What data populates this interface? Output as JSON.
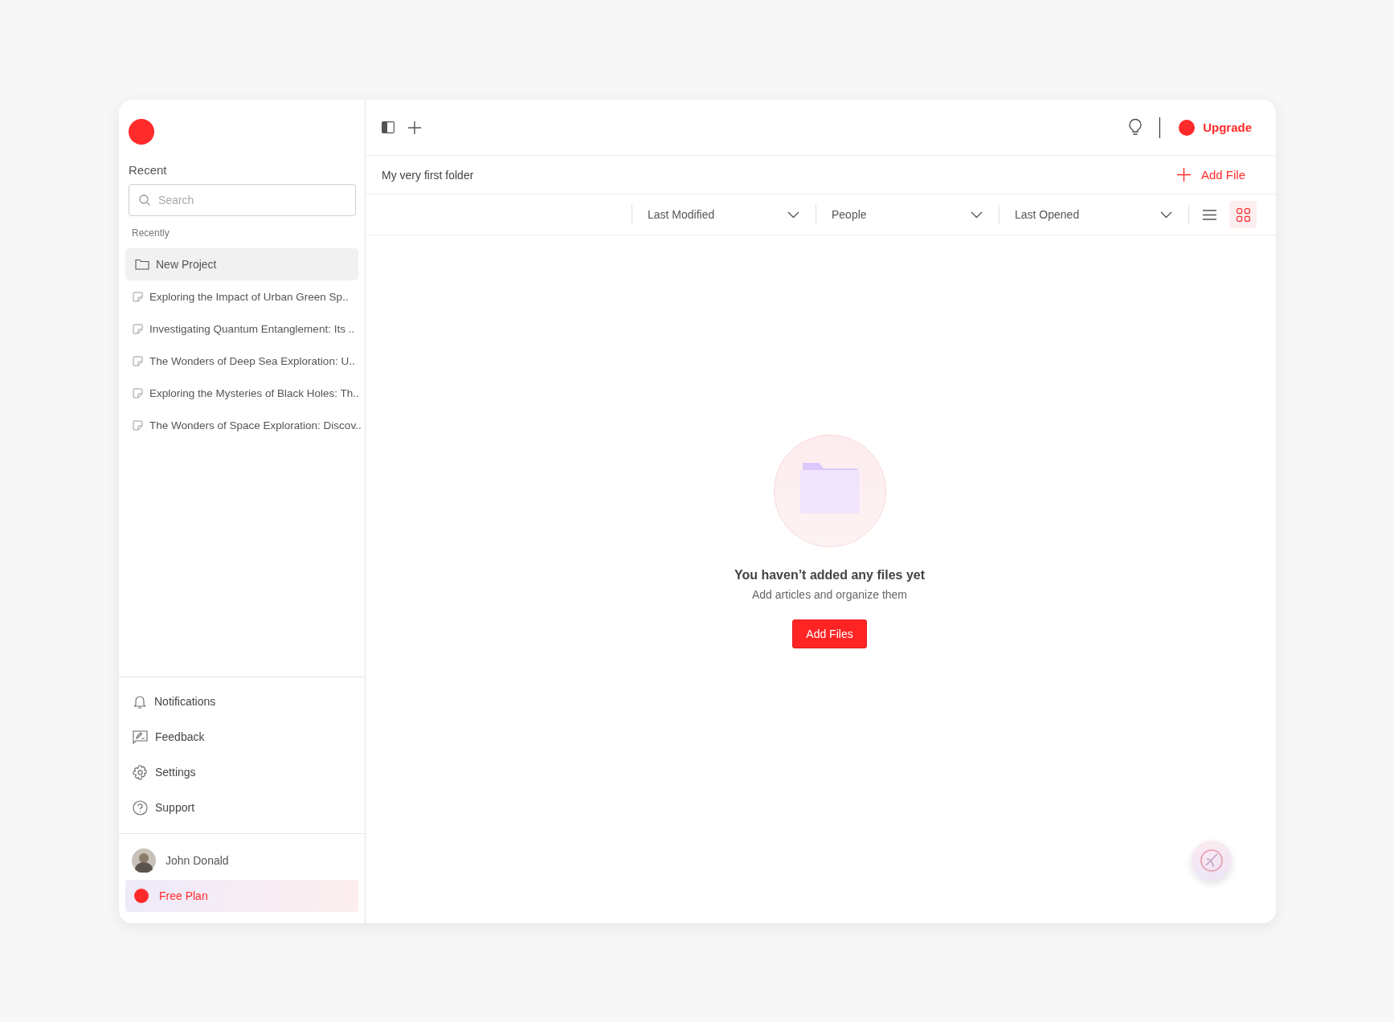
{
  "sidebar": {
    "section_title": "Recent",
    "search": {
      "placeholder": "Search"
    },
    "group_label": "Recently",
    "items": [
      {
        "kind": "folder",
        "label": "New Project",
        "selected": true
      },
      {
        "kind": "document",
        "label": "Exploring the Impact of Urban Green Sp..",
        "selected": false
      },
      {
        "kind": "document",
        "label": "Investigating Quantum Entanglement: Its ..",
        "selected": false
      },
      {
        "kind": "document",
        "label": "The Wonders of Deep Sea Exploration: U..",
        "selected": false
      },
      {
        "kind": "document",
        "label": "Exploring the Mysteries of Black Holes: Th..",
        "selected": false
      },
      {
        "kind": "document",
        "label": "The Wonders of Space Exploration: Discov..",
        "selected": false
      }
    ],
    "nav": [
      {
        "kind": "notifications",
        "label": "Notifications"
      },
      {
        "kind": "feedback",
        "label": "Feedback"
      },
      {
        "kind": "settings",
        "label": "Settings"
      },
      {
        "kind": "support",
        "label": "Support"
      }
    ],
    "user": {
      "name": "John Donald"
    },
    "plan": {
      "label": "Free Plan"
    }
  },
  "toolbar": {
    "upgrade": "Upgrade"
  },
  "folder": {
    "name": "My very first folder",
    "add_button": "Add File"
  },
  "filters": [
    {
      "label": "Last Modified"
    },
    {
      "label": "People"
    },
    {
      "label": "Last Opened"
    }
  ],
  "view_modes": [
    {
      "kind": "list",
      "selected": false
    },
    {
      "kind": "grid",
      "selected": true
    }
  ],
  "empty_state": {
    "title": "You haven’t added any files yet",
    "subtitle": "Add articles and organize them",
    "button": "Add Files"
  }
}
